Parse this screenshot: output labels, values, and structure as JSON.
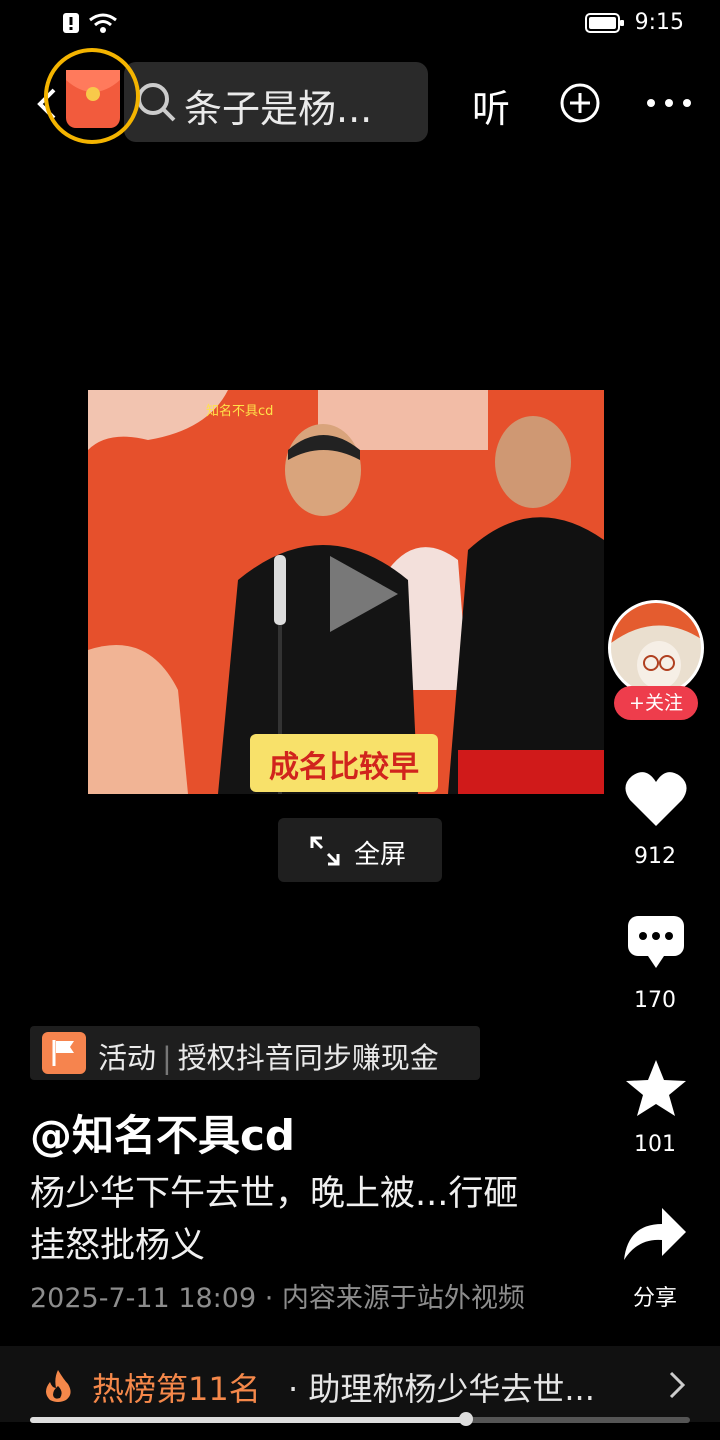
{
  "status": {
    "time": "9:15"
  },
  "top": {
    "search_text": "条子是杨...",
    "listen_label": "听"
  },
  "video": {
    "watermark": "知名不具cd",
    "subtitle": "成名比较早",
    "fullscreen_label": "全屏"
  },
  "rail": {
    "follow_label": "+关注",
    "likes": "912",
    "comments": "170",
    "favorites": "101",
    "share_label": "分享"
  },
  "post": {
    "activity_tag": "活动",
    "activity_text": "授权抖音同步赚现金",
    "author": "@知名不具cd",
    "description": "杨少华下午去世，晚上被...行砸挂怒批杨义",
    "meta": "2025-7-11 18:09 · 内容来源于站外视频"
  },
  "hot": {
    "rank": "热榜第11名",
    "title": "· 助理称杨少华去世..."
  },
  "playback": {
    "progress": 0.66
  },
  "colors": {
    "accent": "#ee3d4c",
    "hot": "#f5884a",
    "ring": "#f4b400"
  }
}
